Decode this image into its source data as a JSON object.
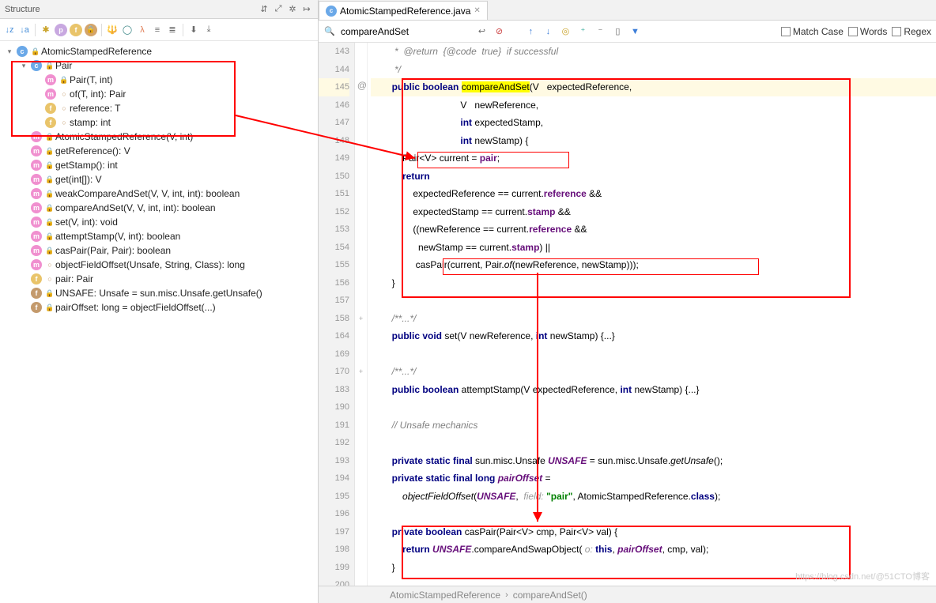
{
  "structure": {
    "title": "Structure",
    "tree": [
      {
        "indent": 0,
        "tw": "▾",
        "badge": "c",
        "bcolor": "#6aa8e8",
        "lock": true,
        "label": "AtomicStampedReference"
      },
      {
        "indent": 1,
        "tw": "▾",
        "badge": "c",
        "bcolor": "#6aa8e8",
        "lock": true,
        "label": "Pair"
      },
      {
        "indent": 2,
        "tw": "",
        "badge": "m",
        "bcolor": "#f08fcf",
        "lock": true,
        "label": "Pair(T, int)"
      },
      {
        "indent": 2,
        "tw": "",
        "badge": "m",
        "bcolor": "#f08fcf",
        "dot": true,
        "label": "of(T, int): Pair<T>"
      },
      {
        "indent": 2,
        "tw": "",
        "badge": "f",
        "bcolor": "#e9c46a",
        "dot": true,
        "label": "reference: T"
      },
      {
        "indent": 2,
        "tw": "",
        "badge": "f",
        "bcolor": "#e9c46a",
        "dot": true,
        "label": "stamp: int"
      },
      {
        "indent": 1,
        "tw": "",
        "badge": "m",
        "bcolor": "#f08fcf",
        "lock": true,
        "label": "AtomicStampedReference(V, int)"
      },
      {
        "indent": 1,
        "tw": "",
        "badge": "m",
        "bcolor": "#f08fcf",
        "lock": true,
        "label": "getReference(): V"
      },
      {
        "indent": 1,
        "tw": "",
        "badge": "m",
        "bcolor": "#f08fcf",
        "lock": true,
        "label": "getStamp(): int"
      },
      {
        "indent": 1,
        "tw": "",
        "badge": "m",
        "bcolor": "#f08fcf",
        "lock": true,
        "label": "get(int[]): V"
      },
      {
        "indent": 1,
        "tw": "",
        "badge": "m",
        "bcolor": "#f08fcf",
        "lock": true,
        "label": "weakCompareAndSet(V, V, int, int): boolean"
      },
      {
        "indent": 1,
        "tw": "",
        "badge": "m",
        "bcolor": "#f08fcf",
        "lock": true,
        "label": "compareAndSet(V, V, int, int): boolean"
      },
      {
        "indent": 1,
        "tw": "",
        "badge": "m",
        "bcolor": "#f08fcf",
        "lock": true,
        "label": "set(V, int): void"
      },
      {
        "indent": 1,
        "tw": "",
        "badge": "m",
        "bcolor": "#f08fcf",
        "lock": true,
        "label": "attemptStamp(V, int): boolean"
      },
      {
        "indent": 1,
        "tw": "",
        "badge": "m",
        "bcolor": "#f08fcf",
        "lock": true,
        "label": "casPair(Pair<V>, Pair<V>): boolean"
      },
      {
        "indent": 1,
        "tw": "",
        "badge": "m",
        "bcolor": "#f08fcf",
        "dot": true,
        "label": "objectFieldOffset(Unsafe, String, Class<?>): long"
      },
      {
        "indent": 1,
        "tw": "",
        "badge": "f",
        "bcolor": "#e9c46a",
        "dot": true,
        "label": "pair: Pair<V>"
      },
      {
        "indent": 1,
        "tw": "",
        "badge": "f",
        "bcolor": "#c49a6c",
        "lock": true,
        "label": "UNSAFE: Unsafe = sun.misc.Unsafe.getUnsafe()"
      },
      {
        "indent": 1,
        "tw": "",
        "badge": "f",
        "bcolor": "#c49a6c",
        "lock": true,
        "label": "pairOffset: long = objectFieldOffset(...)"
      }
    ]
  },
  "tab": {
    "icon": "c",
    "label": "AtomicStampedReference.java"
  },
  "search": {
    "query": "compareAndSet",
    "matchCase": "Match Case",
    "words": "Words",
    "regex": "Regex"
  },
  "lines": [
    "143",
    "144",
    "145",
    "146",
    "147",
    "148",
    "149",
    "150",
    "151",
    "152",
    "153",
    "154",
    "155",
    "156",
    "157",
    "158",
    "164",
    "169",
    "170",
    "183",
    "190",
    "191",
    "192",
    "193",
    "194",
    "195",
    "196",
    "197",
    "198",
    "199",
    "200"
  ],
  "fold": [
    "",
    "",
    "",
    "",
    "",
    "",
    "",
    "",
    "",
    "",
    "",
    "",
    "",
    "",
    "",
    "+",
    "",
    "",
    "+",
    "",
    "",
    "",
    "",
    "",
    "",
    "",
    "",
    "",
    "",
    "",
    ""
  ],
  "code": {
    "l0": "         *  @return  {@code  true}  if successful",
    "l1": "         */",
    "l2a": "        public boolean ",
    "l2b": "compareAndSet",
    "l2c": "(V   expectedReference,",
    "l3": "                                  V   newReference,",
    "l4": "                                  int expectedStamp,",
    "l5": "                                  int newStamp) {",
    "l6": "            Pair<V> current = pair;",
    "l7": "            return",
    "l8": "                expectedReference == current.reference &&",
    "l9": "                expectedStamp == current.stamp &&",
    "l10": "                ((newReference == current.reference &&",
    "l11": "                  newStamp == current.stamp) ||",
    "l12": "                 casPair(current, Pair.of(newReference, newStamp)));",
    "l13": "        }",
    "l14": "",
    "l15": "        /**...*/",
    "l16": "        public void set(V newReference, int newStamp) {...}",
    "l17": "",
    "l18": "        /**...*/",
    "l19": "        public boolean attemptStamp(V expectedReference, int newStamp) {...}",
    "l20": "",
    "l21": "        // Unsafe mechanics",
    "l22": "",
    "l23": "        private static final sun.misc.Unsafe UNSAFE = sun.misc.Unsafe.getUnsafe();",
    "l24": "        private static final long pairOffset =",
    "l25a": "            objectFieldOffset(UNSAFE,  ",
    "l25b": "field: ",
    "l25c": "\"pair\", AtomicStampedReference.class);",
    "l26": "",
    "l27": "        private boolean casPair(Pair<V> cmp, Pair<V> val) {",
    "l28a": "            return UNSAFE.compareAndSwapObject( ",
    "l28b": "o: ",
    "l28c": "this, pairOffset, cmp, val);",
    "l29": "        }"
  },
  "breadcrumb": {
    "a": "AtomicStampedReference",
    "b": "compareAndSet()"
  },
  "watermark": "https://blog.csdn.net/@51CTO博客"
}
